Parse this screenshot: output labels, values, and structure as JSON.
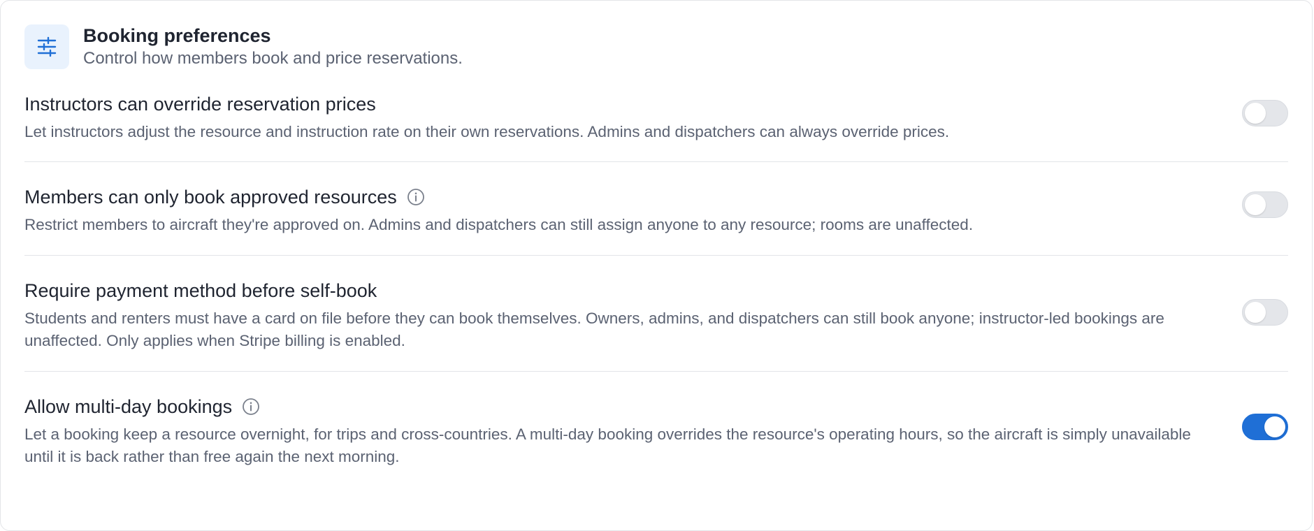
{
  "section": {
    "title": "Booking preferences",
    "subtitle": "Control how members book and price reservations.",
    "icon": "sliders-icon",
    "icon_color": "#1f6fd6"
  },
  "settings": [
    {
      "title": "Instructors can override reservation prices",
      "description": "Let instructors adjust the resource and instruction rate on their own reservations. Admins and dispatchers can always override prices.",
      "has_info_icon": false,
      "enabled": false
    },
    {
      "title": "Members can only book approved resources",
      "description": "Restrict members to aircraft they're approved on. Admins and dispatchers can still assign anyone to any resource; rooms are unaffected.",
      "has_info_icon": true,
      "enabled": false
    },
    {
      "title": "Require payment method before self-book",
      "description": "Students and renters must have a card on file before they can book themselves. Owners, admins, and dispatchers can still book anyone; instructor-led bookings are unaffected. Only applies when Stripe billing is enabled.",
      "has_info_icon": false,
      "enabled": false
    },
    {
      "title": "Allow multi-day bookings",
      "description": "Let a booking keep a resource overnight, for trips and cross-countries. A multi-day booking overrides the resource's operating hours, so the aircraft is simply unavailable until it is back rather than free again the next morning.",
      "has_info_icon": true,
      "enabled": true
    }
  ],
  "colors": {
    "accent": "#1f6fd6",
    "toggle_off": "#e4e6ea"
  }
}
